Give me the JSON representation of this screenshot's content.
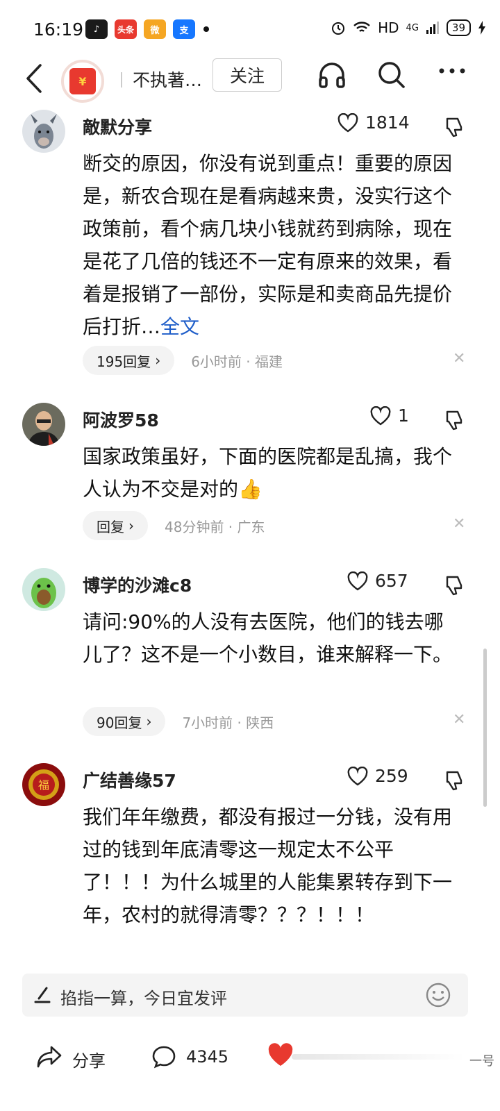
{
  "status_bar": {
    "time": "16:19",
    "apps": [
      {
        "icon": "tiktok-icon",
        "text": "♪",
        "color": "#1a1a1a"
      },
      {
        "icon": "toutiao-icon",
        "text": "头条",
        "color": "#e8392f"
      },
      {
        "icon": "weibo-icon",
        "text": "微",
        "color": "#f5a623"
      },
      {
        "icon": "alipay-icon",
        "text": "支",
        "color": "#1677ff"
      }
    ],
    "network": "HD",
    "signal": "4G",
    "battery": "39"
  },
  "header": {
    "author_name": "不执著…",
    "follow_label": "关注"
  },
  "comments": [
    {
      "name": "敵默分享",
      "likes": "1814",
      "text": "断交的原因，你没有说到重点！重要的原因是，新农合现在是看病越来贵，没实行这个政策前，看个病几块小钱就药到病除，现在是花了几倍的钱还不一定有原来的效果，看着是报销了一部份，实际是和卖商品先提价后打折…",
      "more_link": "全文",
      "replies": "195回复",
      "meta": "6小时前 · 福建"
    },
    {
      "name": "阿波罗58",
      "likes": "1",
      "text": "国家政策虽好，下面的医院都是乱搞，我个人认为不交是对的👍",
      "replies": "回复",
      "meta": "48分钟前 · 广东"
    },
    {
      "name": "博学的沙滩c8",
      "likes": "657",
      "text": "请问:90%的人没有去医院，他们的钱去哪儿了？这不是一个小数目，谁来解释一下。",
      "replies": "90回复",
      "meta": "7小时前 · 陕西"
    },
    {
      "name": "广结善缘57",
      "likes": "259",
      "text": "我们年年缴费，都没有报过一分钱，没有用过的钱到年底清零这一规定太不公平了！！！为什么城里的人能集累转存到下一年，农村的就得清零？？？！！！"
    }
  ],
  "input": {
    "placeholder": "掐指一算，今日宜发评"
  },
  "bottom": {
    "share_label": "分享",
    "comment_count": "4345",
    "side_label": "一号"
  },
  "colors": {
    "link": "#1f5ec9",
    "like_red": "#e8392f"
  }
}
